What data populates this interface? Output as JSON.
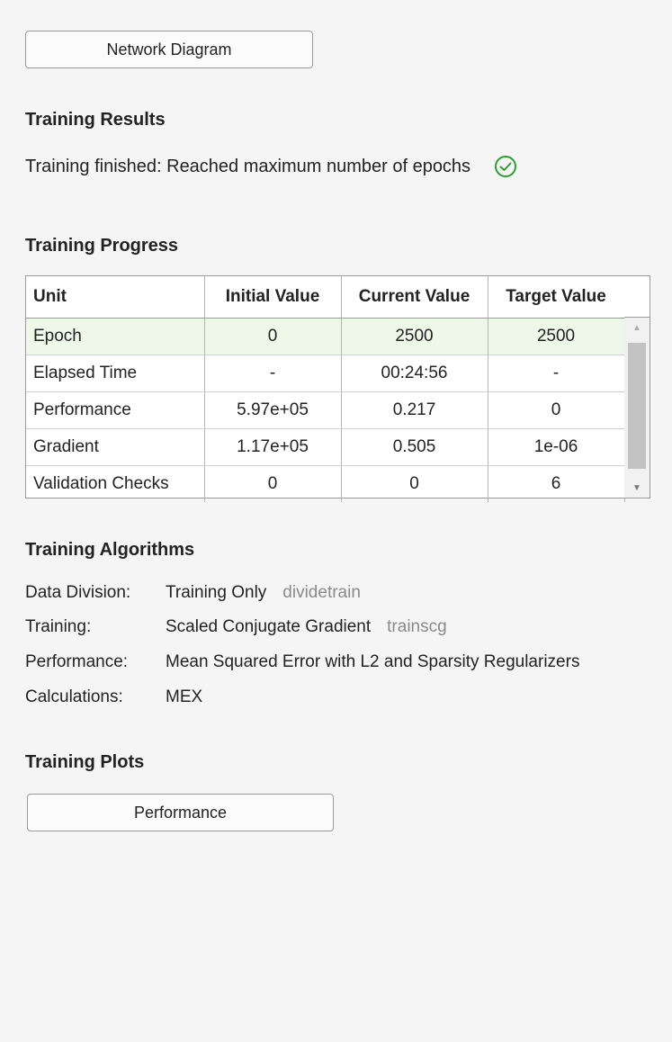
{
  "buttons": {
    "network_diagram": "Network Diagram",
    "performance_plot": "Performance"
  },
  "results": {
    "title": "Training Results",
    "status": "Training finished: Reached maximum number of epochs",
    "status_icon": "check-circle-icon",
    "status_color": "#2e9e2e"
  },
  "progress": {
    "title": "Training Progress",
    "columns": [
      "Unit",
      "Initial Value",
      "Current Value",
      "Target Value"
    ],
    "rows": [
      [
        "Epoch",
        "0",
        "2500",
        "2500"
      ],
      [
        "Elapsed Time",
        "-",
        "00:24:56",
        "-"
      ],
      [
        "Performance",
        "5.97e+05",
        "0.217",
        "0"
      ],
      [
        "Gradient",
        "1.17e+05",
        "0.505",
        "1e-06"
      ],
      [
        "Validation Checks",
        "0",
        "0",
        "6"
      ]
    ],
    "selected_row_color": "#eef8e8"
  },
  "algorithms": {
    "title": "Training Algorithms",
    "items": [
      {
        "label": "Data Division:",
        "value": "Training Only",
        "fn": "dividetrain"
      },
      {
        "label": "Training:",
        "value": "Scaled Conjugate Gradient",
        "fn": "trainscg"
      },
      {
        "label": "Performance:",
        "value": "Mean Squared Error with L2 and Sparsity Regularizers",
        "fn": ""
      },
      {
        "label": "Calculations:",
        "value": "MEX",
        "fn": ""
      }
    ]
  },
  "plots": {
    "title": "Training Plots"
  }
}
